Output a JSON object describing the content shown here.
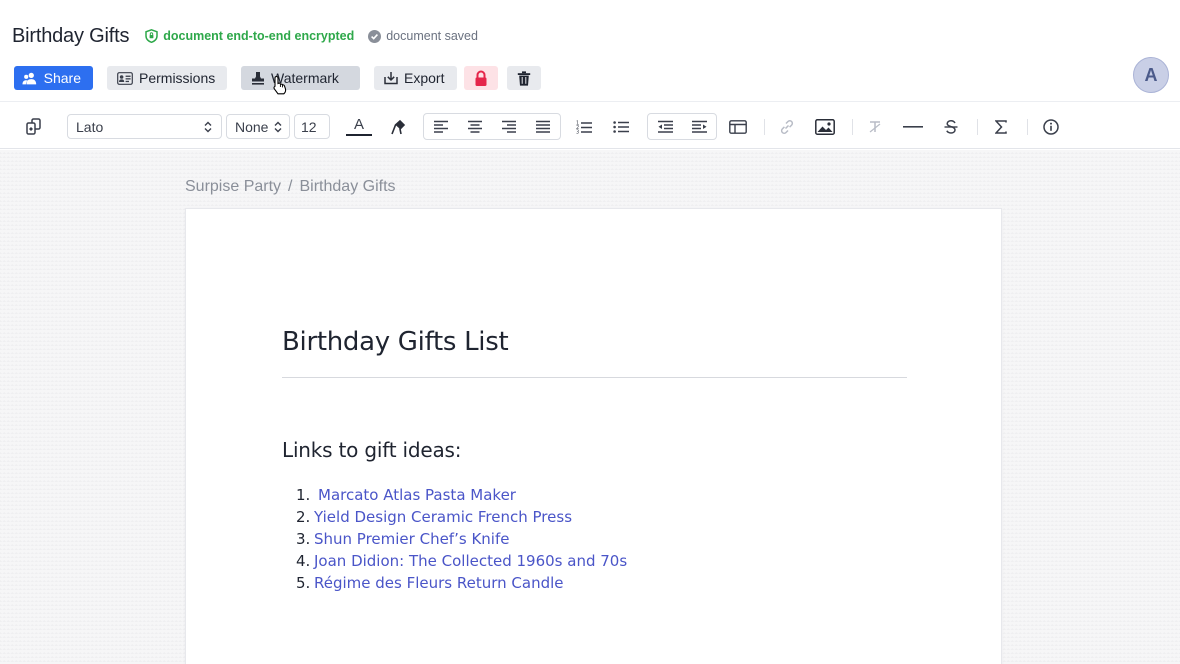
{
  "header": {
    "title": "Birthday Gifts",
    "encryption_status": "document end-to-end encrypted",
    "save_status": "document saved",
    "avatar_initial": "A"
  },
  "actions": {
    "share": "Share",
    "permissions": "Permissions",
    "watermark": "Watermark",
    "export": "Export"
  },
  "toolbar": {
    "font_family": "Lato",
    "heading_style": "None",
    "font_size": "12",
    "text_color_glyph": "A"
  },
  "breadcrumb": {
    "parent": "Surpise Party",
    "separator": "/",
    "current": "Birthday Gifts"
  },
  "document": {
    "heading": "Birthday Gifts List",
    "subheading": "Links to gift ideas:",
    "gifts": [
      {
        "num": "1.",
        "label": "Marcato Atlas Pasta Maker"
      },
      {
        "num": "2.",
        "label": "Yield Design Ceramic French Press"
      },
      {
        "num": "3.",
        "label": "Shun Premier Chef’s Knife"
      },
      {
        "num": "4.",
        "label": "Joan Didion: The Collected 1960s and 70s"
      },
      {
        "num": "5.",
        "label": "Régime des Fleurs Return Candle"
      }
    ]
  },
  "colors": {
    "primary": "#2d6ff0",
    "encrypted": "#2ea84a",
    "link": "#4a55c8",
    "lock_bg": "#fde2e6",
    "lock_icon": "#e5254a"
  }
}
